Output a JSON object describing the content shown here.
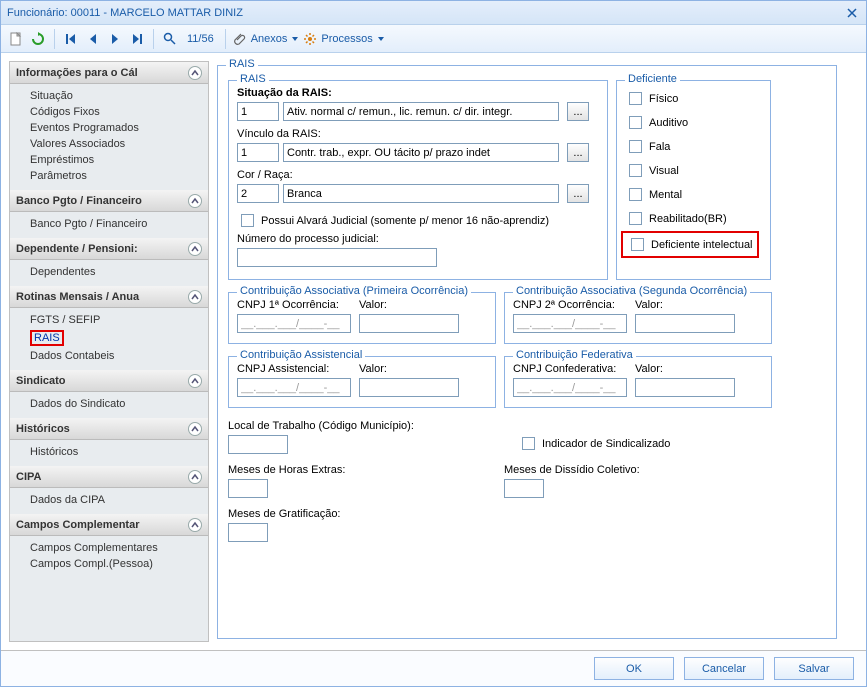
{
  "window": {
    "title": "Funcionário: 00011 - MARCELO MATTAR DINIZ"
  },
  "toolbar": {
    "page_counter": "11/56",
    "anexos": "Anexos",
    "processos": "Processos"
  },
  "sidebar": {
    "groups": [
      {
        "title": "Informações para o Cál",
        "items": [
          "Situação",
          "Códigos Fixos",
          "Eventos Programados",
          "Valores Associados",
          "Empréstimos",
          "Parâmetros"
        ]
      },
      {
        "title": "Banco Pgto / Financeiro",
        "items": [
          "Banco Pgto / Financeiro"
        ]
      },
      {
        "title": "Dependente / Pensioni:",
        "items": [
          "Dependentes"
        ]
      },
      {
        "title": "Rotinas Mensais / Anua",
        "items": [
          "FGTS / SEFIP",
          "RAIS",
          "Dados Contabeis"
        ],
        "selected": 1
      },
      {
        "title": "Sindicato",
        "items": [
          "Dados do Sindicato"
        ]
      },
      {
        "title": "Históricos",
        "items": [
          "Históricos"
        ]
      },
      {
        "title": "CIPA",
        "items": [
          "Dados da CIPA"
        ]
      },
      {
        "title": "Campos Complementar",
        "items": [
          "Campos Complementares",
          "Campos Compl.(Pessoa)"
        ]
      }
    ]
  },
  "rais": {
    "outer_legend": "RAIS",
    "inner_legend": "RAIS",
    "situacao_label": "Situação da RAIS:",
    "situacao_code": "1",
    "situacao_desc": "Ativ. normal c/ remun., lic. remun. c/ dir. integr.",
    "vinculo_label": "Vínculo da RAIS:",
    "vinculo_code": "1",
    "vinculo_desc": "Contr. trab., expr. OU tácito p/ prazo indet",
    "cor_label": "Cor / Raça:",
    "cor_code": "2",
    "cor_desc": "Branca",
    "alvara_label": "Possui Alvará Judicial (somente p/ menor 16 não-aprendiz)",
    "numproc_label": "Número do processo judicial:"
  },
  "deficiente": {
    "legend": "Deficiente",
    "fisico": "Físico",
    "auditivo": "Auditivo",
    "fala": "Fala",
    "visual": "Visual",
    "mental": "Mental",
    "reabilitado": "Reabilitado(BR)",
    "intelectual": "Deficiente intelectual"
  },
  "contrib": {
    "assoc1_legend": "Contribuição Associativa (Primeira Ocorrência)",
    "cnpj1_label": "CNPJ 1ª Ocorrência:",
    "assoc2_legend": "Contribuição Associativa (Segunda Ocorrência)",
    "cnpj2_label": "CNPJ 2ª Ocorrência:",
    "assist_legend": "Contribuição Assistencial",
    "cnpj_assist_label": "CNPJ Assistencial:",
    "feder_legend": "Contribuição Federativa",
    "cnpj_confed_label": "CNPJ Confederativa:",
    "valor_label": "Valor:",
    "cnpj_mask": "__.___.___/____-__"
  },
  "labels": {
    "local_trabalho": "Local de Trabalho (Código Município):",
    "indicador_sind": "Indicador de Sindicalizado",
    "meses_he": "Meses de Horas Extras:",
    "meses_dc": "Meses de Dissídio Coletivo:",
    "meses_grat": "Meses de Gratificação:"
  },
  "footer": {
    "ok": "OK",
    "cancel": "Cancelar",
    "save": "Salvar"
  }
}
